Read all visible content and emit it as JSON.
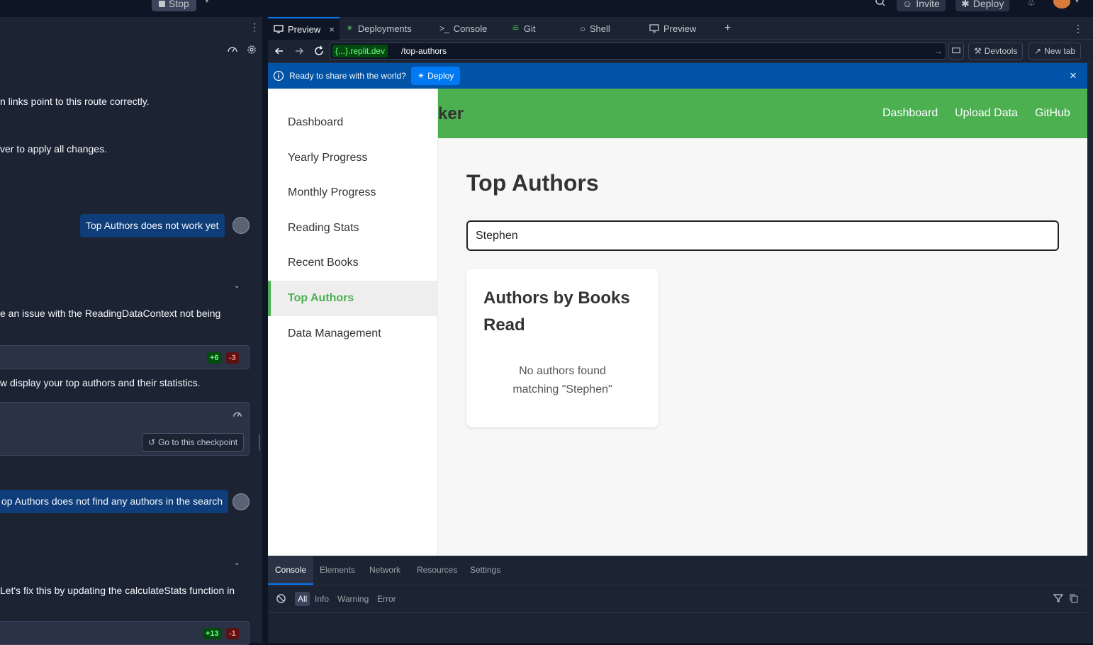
{
  "topbar": {
    "stop_label": "Stop",
    "invite_label": "Invite",
    "deploy_label": "Deploy"
  },
  "chat": {
    "lines": [
      "n links point to this route correctly.",
      "ver to apply all changes.",
      "e an issue with the ReadingDataContext not being",
      "w display your top authors and their statistics.",
      "Let's fix this by updating the calculateStats function in"
    ],
    "user_messages": [
      "Top Authors does not work yet",
      "op Authors does not find any authors in the search"
    ],
    "diffs": [
      {
        "added": "+6",
        "removed": "-3"
      },
      {
        "added": "+13",
        "removed": "-1"
      }
    ],
    "checkpoint_label": "Go to this checkpoint"
  },
  "tabs": [
    {
      "label": "Preview",
      "icon": "monitor-icon"
    },
    {
      "label": "Deployments",
      "icon": "deploy-icon"
    },
    {
      "label": "Console",
      "icon": "terminal-icon"
    },
    {
      "label": "Git",
      "icon": "git-icon"
    },
    {
      "label": "Shell",
      "icon": "shell-icon"
    },
    {
      "label": "Preview",
      "icon": "monitor-icon"
    }
  ],
  "urlbar": {
    "domain": "{...}.replit.dev",
    "path": "/top-authors",
    "devtools_label": "Devtools",
    "newtab_label": "New tab"
  },
  "banner": {
    "message": "Ready to share with the world?",
    "deploy_label": "Deploy"
  },
  "app": {
    "brand_fragment": "ker",
    "header_nav": [
      "Dashboard",
      "Upload Data",
      "GitHub"
    ],
    "sidebar": [
      {
        "label": "Dashboard"
      },
      {
        "label": "Yearly Progress"
      },
      {
        "label": "Monthly Progress"
      },
      {
        "label": "Reading Stats"
      },
      {
        "label": "Recent Books"
      },
      {
        "label": "Top Authors",
        "active": true
      },
      {
        "label": "Data Management"
      }
    ],
    "page_title": "Top Authors",
    "search_value": "Stephen",
    "card_title": "Authors by Books Read",
    "empty_message": "No authors found matching \"Stephen\""
  },
  "devtools": {
    "tabs": [
      "Console",
      "Elements",
      "Network",
      "Resources",
      "Settings"
    ],
    "levels": [
      "All",
      "Info",
      "Warning",
      "Error"
    ]
  },
  "colors": {
    "accent_green": "#4caf50",
    "banner_blue": "#0053a6",
    "bubble_blue": "#0f3d79"
  }
}
